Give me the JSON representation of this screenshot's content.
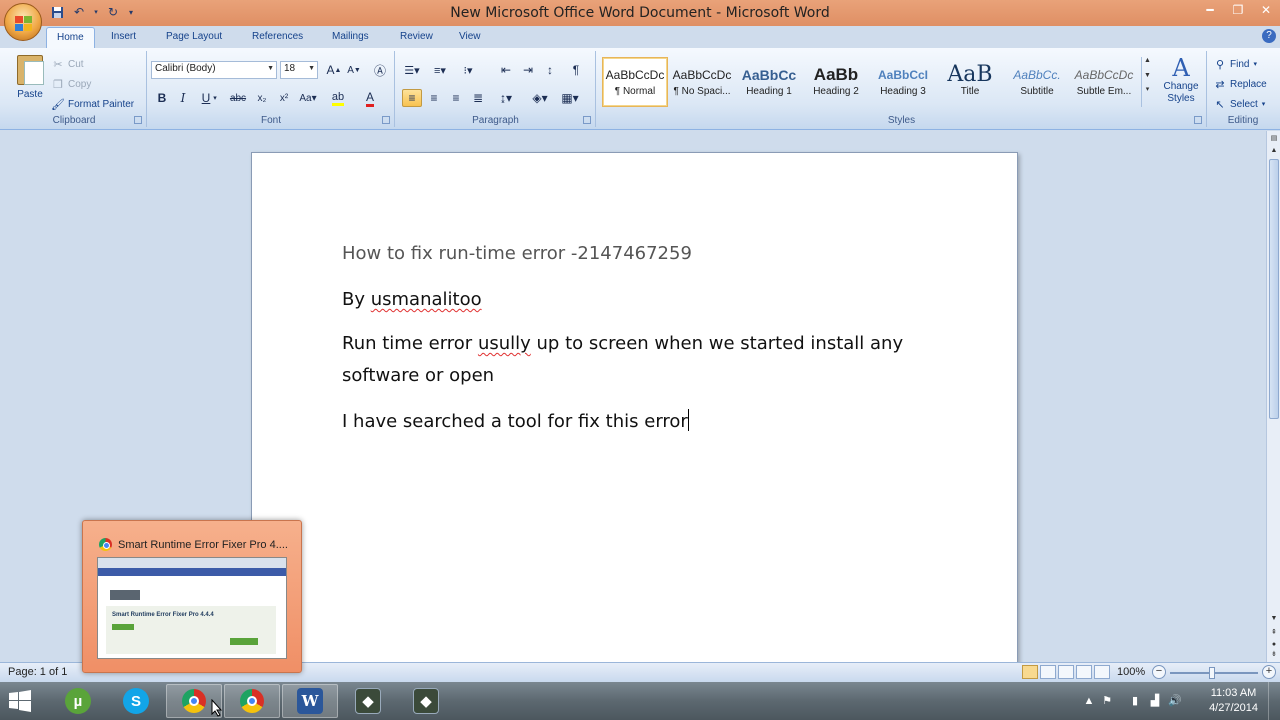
{
  "window": {
    "title": "New Microsoft Office Word Document - Microsoft Word",
    "minimize_icon": "minimize-icon",
    "restore_icon": "restore-icon",
    "close_icon": "close-icon"
  },
  "tabs": [
    "Home",
    "Insert",
    "Page Layout",
    "References",
    "Mailings",
    "Review",
    "View"
  ],
  "clipboard": {
    "paste": "Paste",
    "cut": "Cut",
    "copy": "Copy",
    "format_painter": "Format Painter",
    "group_label": "Clipboard"
  },
  "font": {
    "family": "Calibri (Body)",
    "size": "18",
    "group_label": "Font"
  },
  "paragraph": {
    "group_label": "Paragraph"
  },
  "styles": {
    "group_label": "Styles",
    "items": [
      {
        "sample": "AaBbCcDc",
        "name": "¶ Normal"
      },
      {
        "sample": "AaBbCcDc",
        "name": "¶ No Spaci..."
      },
      {
        "sample": "AaBbCc",
        "name": "Heading 1"
      },
      {
        "sample": "AaBb",
        "name": "Heading 2"
      },
      {
        "sample": "AaBbCcI",
        "name": "Heading 3"
      },
      {
        "sample": "AaB",
        "name": "Title"
      },
      {
        "sample": "AaBbCc.",
        "name": "Subtitle"
      },
      {
        "sample": "AaBbCcDc",
        "name": "Subtle Em..."
      }
    ],
    "change_styles": "Change Styles"
  },
  "editing": {
    "find": "Find",
    "replace": "Replace",
    "select": "Select",
    "group_label": "Editing"
  },
  "document": {
    "title_line": "How to fix run-time error  -2147467259",
    "byline_prefix": "By ",
    "byline_name": "usmanalitoo",
    "para1_a": "Run time error ",
    "para1_b": "usully",
    "para1_c": " up to screen when we started install any",
    "para1_line2": "software or open",
    "para2": "I have searched a tool for fix this error"
  },
  "status": {
    "page": "Page: 1 of 1",
    "zoom": "100%",
    "zoom_level_percent": 100
  },
  "thumbnail": {
    "title": "Smart Runtime Error Fixer Pro 4....",
    "preview_heading": "Smart Runtime Error Fixer Pro 4.4.4"
  },
  "taskbar": {
    "items": [
      "utorrent",
      "skype",
      "chrome",
      "chrome",
      "word",
      "app",
      "app"
    ],
    "time": "11:03 AM",
    "date": "4/27/2014"
  },
  "colors": {
    "title_bar": "#e39a6f",
    "ribbon": "#dbe7f5",
    "background": "#cfdcec"
  }
}
